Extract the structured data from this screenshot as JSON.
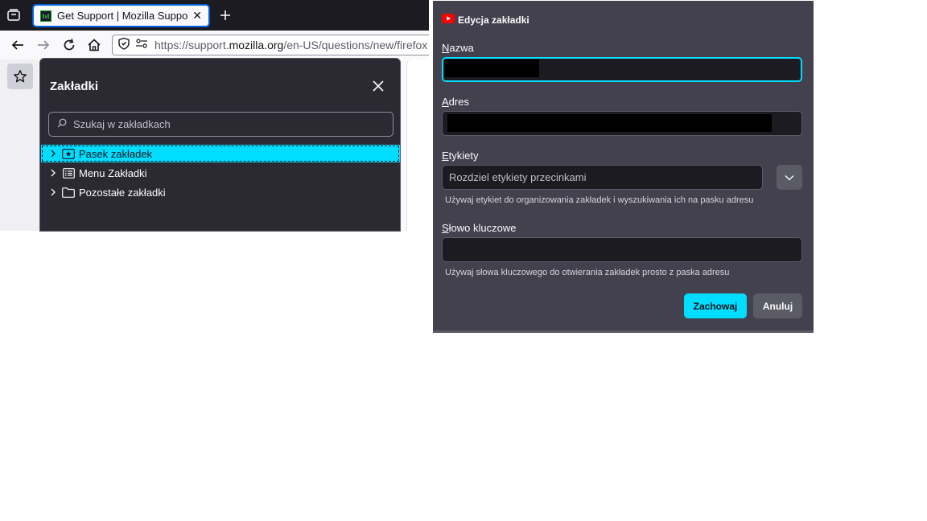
{
  "browser": {
    "tab": {
      "title": "Get Support | Mozilla Support",
      "favicon": "mozilla-support-favicon",
      "close_glyph": "✕"
    },
    "new_tab_glyph": "+",
    "url": {
      "prefix": "https://support.",
      "domain": "mozilla.org",
      "path": "/en-US/questions/new/firefox"
    },
    "icons": [
      "tab-overview-icon",
      "back-icon",
      "forward-icon",
      "reload-icon",
      "home-icon",
      "shield-icon",
      "permissions-icon",
      "star-icon"
    ]
  },
  "bookmarks_panel": {
    "title": "Zakładki",
    "search_placeholder": "Szukaj w zakładkach",
    "items": [
      {
        "label": "Pasek zakładek",
        "icon": "bookmarks-toolbar-icon",
        "selected": true
      },
      {
        "label": "Menu Zakładki",
        "icon": "bookmarks-menu-icon",
        "selected": false
      },
      {
        "label": "Pozostałe zakładki",
        "icon": "folder-icon",
        "selected": false
      }
    ]
  },
  "edit_dialog": {
    "title": "Edycja zakładki",
    "title_icon": "youtube-icon",
    "name_label_first": "N",
    "name_label_rest": "azwa",
    "name_value": "",
    "address_label_first": "A",
    "address_label_rest": "dres",
    "address_value": "",
    "tags_label_first": "E",
    "tags_label_rest": "tykiety",
    "tags_placeholder": "Rozdziel etykiety przecinkami",
    "tags_hint": "Używaj etykiet do organizowania zakładek i wyszukiwania ich na pasku adresu",
    "keyword_label_first": "S",
    "keyword_label_rest": "łowo kluczowe",
    "keyword_value": "",
    "keyword_hint": "Używaj słowa kluczowego do otwierania zakładek prosto z paska adresu",
    "save_label": "Zachowaj",
    "cancel_label": "Anuluj"
  },
  "colors": {
    "accent": "#00ddff",
    "panel_bg": "#2b2a33",
    "dialog_bg": "#42414d",
    "tabstrip_bg": "#1c1b22",
    "focus_ring": "#0061e0"
  }
}
